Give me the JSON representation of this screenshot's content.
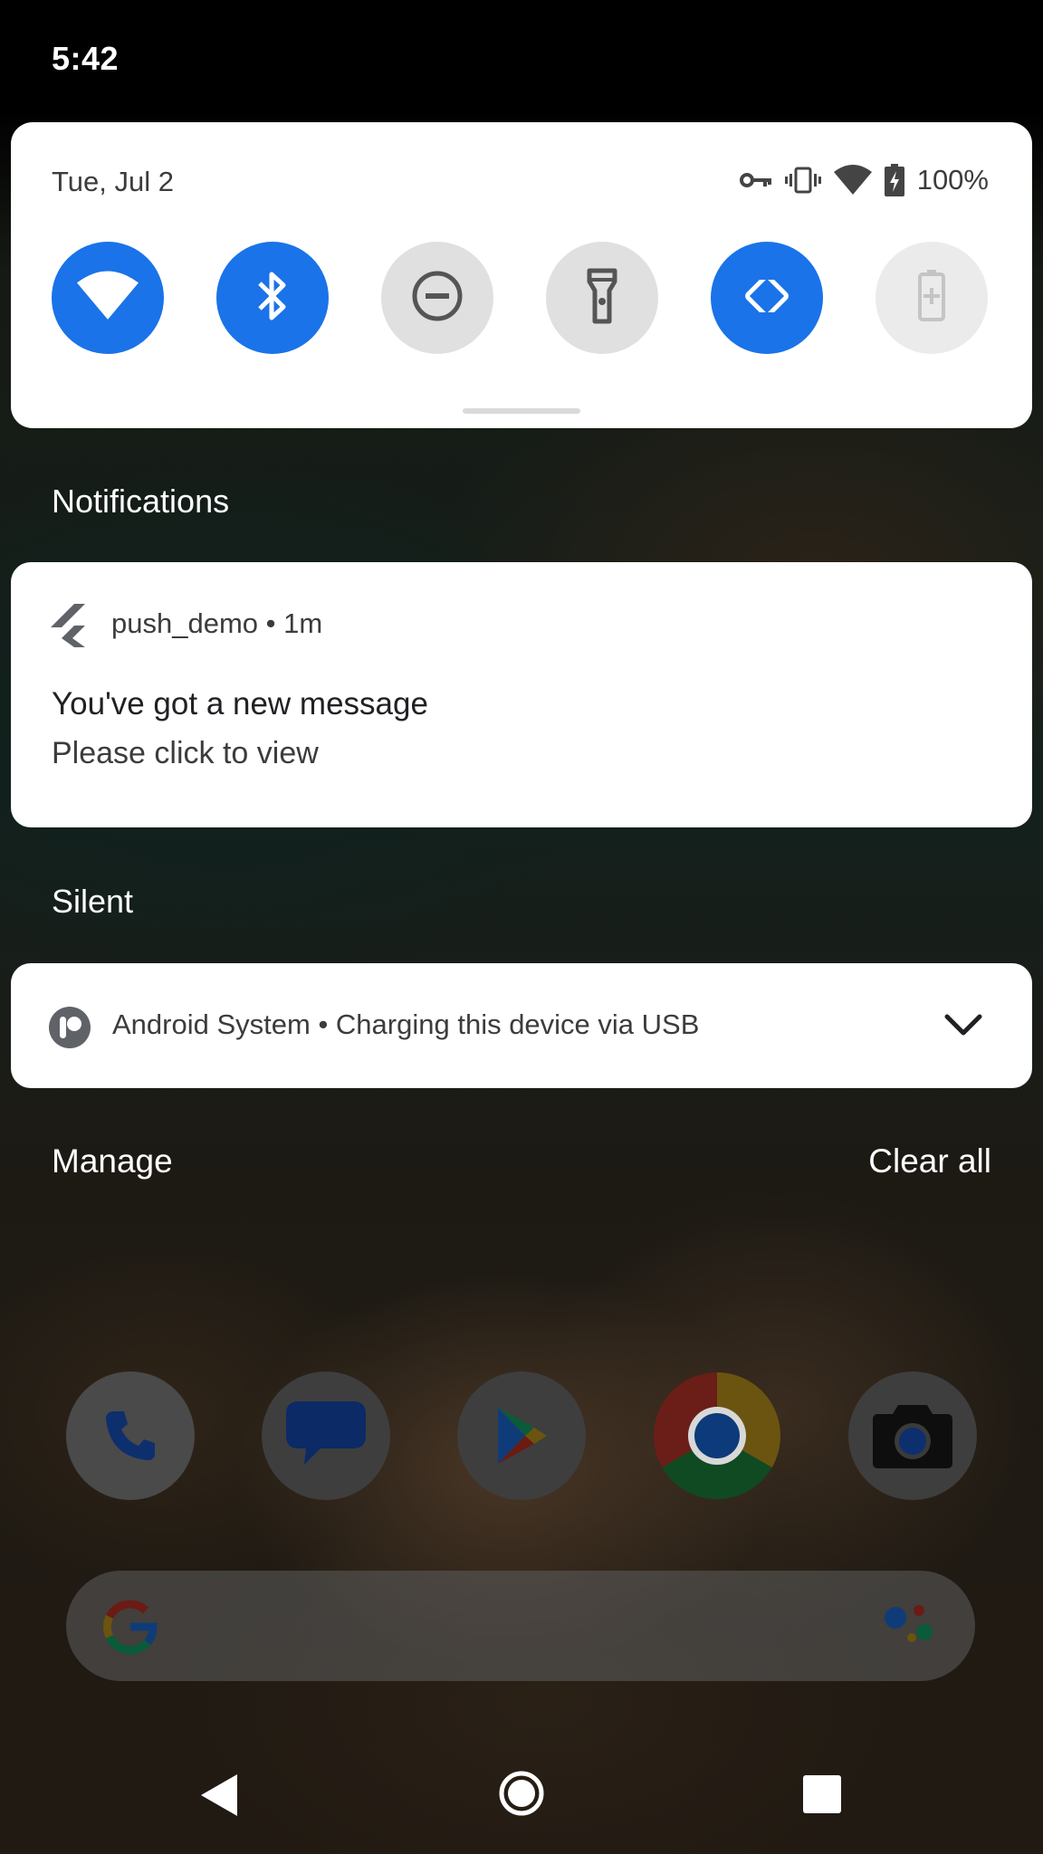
{
  "status_bar": {
    "time": "5:42"
  },
  "quick_settings": {
    "date": "Tue, Jul 2",
    "battery_percent": "100%",
    "status_icons": [
      "vpn-key-icon",
      "vibrate-icon",
      "wifi-icon",
      "battery-charging-icon"
    ],
    "tiles": [
      {
        "name": "wifi",
        "icon": "wifi-icon",
        "state": "on"
      },
      {
        "name": "bluetooth",
        "icon": "bluetooth-icon",
        "state": "on"
      },
      {
        "name": "do-not-disturb",
        "icon": "do-not-disturb-icon",
        "state": "off"
      },
      {
        "name": "flashlight",
        "icon": "flashlight-icon",
        "state": "off"
      },
      {
        "name": "auto-rotate",
        "icon": "auto-rotate-icon",
        "state": "on"
      },
      {
        "name": "battery-saver",
        "icon": "battery-saver-icon",
        "state": "disabled"
      }
    ],
    "accent_color": "#1a73e8"
  },
  "notifications": {
    "header": "Notifications",
    "items": [
      {
        "app": "push_demo",
        "time": "1m",
        "title": "You've got a new message",
        "text": "Please click to view",
        "icon": "flutter-icon"
      }
    ]
  },
  "silent": {
    "header": "Silent",
    "items": [
      {
        "app": "Android System",
        "text": "Charging this device via USB",
        "icon": "android-system-icon"
      }
    ]
  },
  "actions": {
    "manage": "Manage",
    "clear_all": "Clear all"
  },
  "dock": [
    "phone-icon",
    "messages-icon",
    "play-store-icon",
    "chrome-icon",
    "camera-icon"
  ],
  "search": {
    "icons": [
      "google-g-icon",
      "assistant-icon"
    ]
  },
  "nav_bar": [
    "back-icon",
    "home-icon",
    "recents-icon"
  ]
}
